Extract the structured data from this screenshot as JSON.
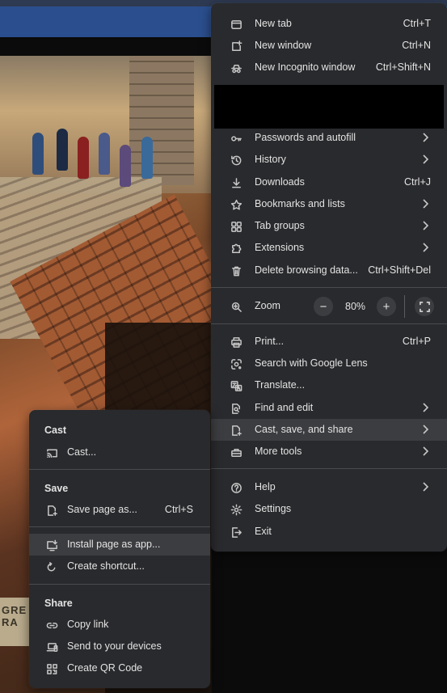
{
  "menu": {
    "new_tab": {
      "label": "New tab",
      "shortcut": "Ctrl+T"
    },
    "new_window": {
      "label": "New window",
      "shortcut": "Ctrl+N"
    },
    "new_incognito": {
      "label": "New Incognito window",
      "shortcut": "Ctrl+Shift+N"
    },
    "passwords": {
      "label": "Passwords and autofill"
    },
    "history": {
      "label": "History"
    },
    "downloads": {
      "label": "Downloads",
      "shortcut": "Ctrl+J"
    },
    "bookmarks": {
      "label": "Bookmarks and lists"
    },
    "tab_groups": {
      "label": "Tab groups"
    },
    "extensions": {
      "label": "Extensions"
    },
    "delete_data": {
      "label": "Delete browsing data...",
      "shortcut": "Ctrl+Shift+Del"
    },
    "zoom": {
      "label": "Zoom",
      "level": "80%",
      "minus": "−",
      "plus": "+"
    },
    "print": {
      "label": "Print...",
      "shortcut": "Ctrl+P"
    },
    "lens": {
      "label": "Search with Google Lens"
    },
    "translate": {
      "label": "Translate..."
    },
    "find_edit": {
      "label": "Find and edit"
    },
    "cast_save_share": {
      "label": "Cast, save, and share"
    },
    "more_tools": {
      "label": "More tools"
    },
    "help": {
      "label": "Help"
    },
    "settings": {
      "label": "Settings"
    },
    "exit": {
      "label": "Exit"
    }
  },
  "submenu": {
    "cast_heading": "Cast",
    "cast": {
      "label": "Cast..."
    },
    "save_heading": "Save",
    "save_page": {
      "label": "Save page as...",
      "shortcut": "Ctrl+S"
    },
    "install_app": {
      "label": "Install page as app..."
    },
    "create_shortcut": {
      "label": "Create shortcut..."
    },
    "share_heading": "Share",
    "copy_link": {
      "label": "Copy link"
    },
    "send_devices": {
      "label": "Send to your devices"
    },
    "qr_code": {
      "label": "Create QR Code"
    }
  },
  "page": {
    "sign_text": "GRE RA"
  }
}
